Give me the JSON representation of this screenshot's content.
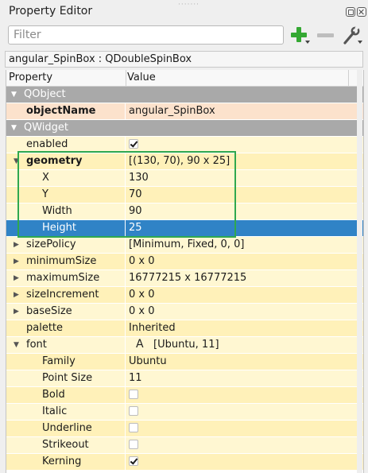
{
  "panel": {
    "title": "Property Editor"
  },
  "filter": {
    "placeholder": "Filter",
    "value": ""
  },
  "object_info": "angular_SpinBox : QDoubleSpinBox",
  "columns": {
    "property": "Property",
    "value": "Value"
  },
  "rows": [
    {
      "kind": "category",
      "name": "QObject",
      "expanded": true
    },
    {
      "kind": "prop",
      "name": "objectName",
      "value": "angular_SpinBox",
      "bold": true,
      "tint": "pk"
    },
    {
      "kind": "category",
      "name": "QWidget",
      "expanded": true
    },
    {
      "kind": "prop",
      "name": "enabled",
      "checkbox": true,
      "checked": true,
      "tint": "y1"
    },
    {
      "kind": "prop",
      "name": "geometry",
      "value": "[(130, 70), 90 x 25]",
      "bold": true,
      "expander": "open",
      "tint": "y2"
    },
    {
      "kind": "prop",
      "name": "X",
      "value": "130",
      "indent": 1,
      "tint": "y1"
    },
    {
      "kind": "prop",
      "name": "Y",
      "value": "70",
      "indent": 1,
      "tint": "y2"
    },
    {
      "kind": "prop",
      "name": "Width",
      "value": "90",
      "indent": 1,
      "tint": "y1"
    },
    {
      "kind": "prop",
      "name": "Height",
      "value": "25",
      "indent": 1,
      "selected": true
    },
    {
      "kind": "prop",
      "name": "sizePolicy",
      "value": "[Minimum, Fixed, 0, 0]",
      "expander": "closed",
      "tint": "y1"
    },
    {
      "kind": "prop",
      "name": "minimumSize",
      "value": "0 x 0",
      "expander": "closed",
      "tint": "y2"
    },
    {
      "kind": "prop",
      "name": "maximumSize",
      "value": "16777215 x 16777215",
      "expander": "closed",
      "tint": "y1"
    },
    {
      "kind": "prop",
      "name": "sizeIncrement",
      "value": "0 x 0",
      "expander": "closed",
      "tint": "y2"
    },
    {
      "kind": "prop",
      "name": "baseSize",
      "value": "0 x 0",
      "expander": "closed",
      "tint": "y1"
    },
    {
      "kind": "prop",
      "name": "palette",
      "value": "Inherited",
      "tint": "y2"
    },
    {
      "kind": "prop",
      "name": "font",
      "value": "[Ubuntu, 11]",
      "font_icon": "A",
      "expander": "open",
      "tint": "y1"
    },
    {
      "kind": "prop",
      "name": "Family",
      "value": "Ubuntu",
      "indent": 1,
      "tint": "y2"
    },
    {
      "kind": "prop",
      "name": "Point Size",
      "value": "11",
      "indent": 1,
      "tint": "y1"
    },
    {
      "kind": "prop",
      "name": "Bold",
      "checkbox": true,
      "checked": false,
      "indent": 1,
      "tint": "y2"
    },
    {
      "kind": "prop",
      "name": "Italic",
      "checkbox": true,
      "checked": false,
      "indent": 1,
      "tint": "y1"
    },
    {
      "kind": "prop",
      "name": "Underline",
      "checkbox": true,
      "checked": false,
      "indent": 1,
      "tint": "y2"
    },
    {
      "kind": "prop",
      "name": "Strikeout",
      "checkbox": true,
      "checked": false,
      "indent": 1,
      "tint": "y1"
    },
    {
      "kind": "prop",
      "name": "Kerning",
      "checkbox": true,
      "checked": true,
      "indent": 1,
      "tint": "y2"
    }
  ],
  "colors": {
    "selection": "#3083c6",
    "highlight_box": "#2fa84f",
    "category": "#a9a9a9",
    "add_icon": "#34a832"
  }
}
